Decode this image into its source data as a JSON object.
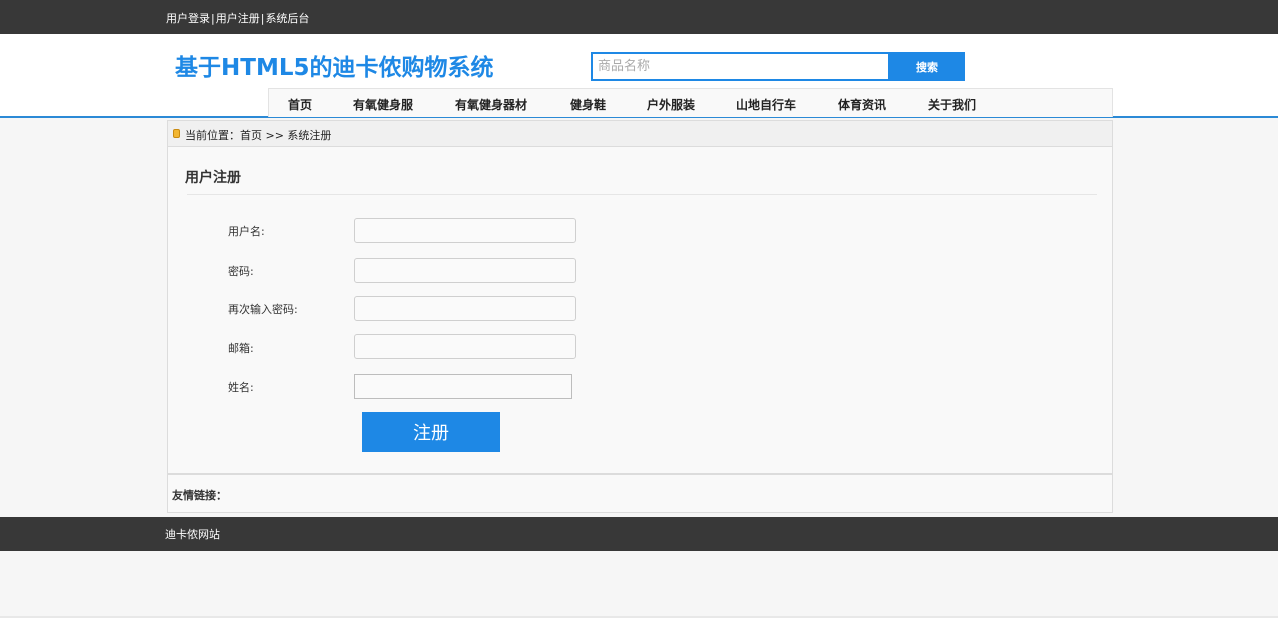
{
  "topbar": {
    "links": [
      "用户登录",
      "用户注册",
      "系统后台"
    ],
    "separator": "|"
  },
  "header": {
    "site_title": "基于HTML5的迪卡侬购物系统",
    "search_placeholder": "商品名称",
    "search_button": "搜索"
  },
  "nav": {
    "items": [
      "首页",
      "有氧健身服",
      "有氧健身器材",
      "健身鞋",
      "户外服装",
      "山地自行车",
      "体育资讯",
      "关于我们"
    ]
  },
  "breadcrumb": {
    "text": "当前位置：首页 >> 系统注册"
  },
  "register": {
    "title": "用户注册",
    "fields": [
      {
        "label": "用户名:",
        "value": ""
      },
      {
        "label": "密码:",
        "value": ""
      },
      {
        "label": "再次输入密码:",
        "value": ""
      },
      {
        "label": "邮箱:",
        "value": ""
      },
      {
        "label": "姓名:",
        "value": ""
      }
    ],
    "submit": "注册"
  },
  "friend_links": {
    "title": "友情链接："
  },
  "footer": {
    "text": "迪卡侬网站"
  },
  "colors": {
    "accent": "#1e88e5",
    "dark_bar": "#383838"
  }
}
